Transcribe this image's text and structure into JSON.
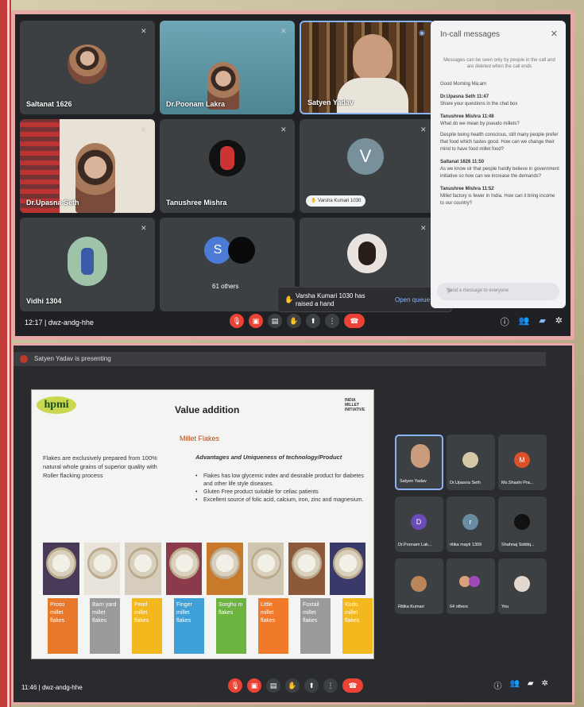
{
  "top": {
    "tiles": [
      {
        "name": "Saltanat 1626"
      },
      {
        "name": "Dr.Poonam Lakra"
      },
      {
        "name": "Satyen Yadav"
      },
      {
        "name": "Dr.Upasna Seth"
      },
      {
        "name": "Tanushree Mishra"
      },
      {
        "name": "Varsha Kumari 1030",
        "initial": "V"
      },
      {
        "name": "Vidhi 1304"
      },
      {
        "name": "61 others",
        "initial": "S"
      },
      {
        "name": ""
      }
    ],
    "chat": {
      "title": "In-call messages",
      "note": "Messages can be seen only by people in the call and are deleted when the call ends",
      "messages": [
        {
          "who": "",
          "text": "Good Morning Ma;am"
        },
        {
          "who": "Dr.Upasna Seth  11:47",
          "text": "Share your questions in the chat box"
        },
        {
          "who": "Tanushree Mishra  11:48",
          "text": "What do we mean by pseudo millets?"
        },
        {
          "who": "",
          "text": "Despite being health conscious, still many people prefer that food which tastes good. How can we change their mind to have food millet food?"
        },
        {
          "who": "Saltanat 1626  11:50",
          "text": "As we know sir that people hardly believe in government initiative so how can we increase the demands?"
        },
        {
          "who": "Tanushree Mishra  11:52",
          "text": "Millet factory is fewer in India. How can it bring income to our country?"
        }
      ],
      "input_placeholder": "Send a message to everyone"
    },
    "toast": {
      "text": "Varsha Kumari 1030 has raised a hand",
      "action": "Open queue"
    },
    "time_code": "12:17  |  dwz-andg-hhe"
  },
  "bottom": {
    "presenting": "Satyen Yadav is presenting",
    "slide": {
      "logo": "hpmi",
      "title": "Value addition",
      "logo_right": "INDIA MILLET INITIATIVE",
      "subtitle": "Millet Flakes",
      "left_text": "Flakes are exclusively prepared from 100% natural whole grains of superior quality with Roller flacking process",
      "adv_title": "Advantages and Uniqueness of technology/Product",
      "bullets": [
        "Flakes has low glycemic index and desirable product for diabetes and other life style diseases.",
        "Gluten Free product suitable for celiac patients",
        "Excellent source of folic acid, calcium, iron, zinc and magnesium."
      ],
      "labels": [
        {
          "text": "Proso millet flakes",
          "color": "#e8782a"
        },
        {
          "text": "Barn yard millet flakes",
          "color": "#9a9a9a"
        },
        {
          "text": "Pearl millet flakes",
          "color": "#f3b81e"
        },
        {
          "text": "Finger millet flakes",
          "color": "#3fa0d8"
        },
        {
          "text": "Sorghu m flakes",
          "color": "#6db33f"
        },
        {
          "text": "Little millet flakes",
          "color": "#f07a2a"
        },
        {
          "text": "Foxtail millet flakes",
          "color": "#9a9a9a"
        },
        {
          "text": "Kodo millet flakes",
          "color": "#f3b81e"
        }
      ]
    },
    "participants": [
      {
        "name": "Satyen Yadav",
        "initial": "",
        "color": ""
      },
      {
        "name": "Dr.Upasna Seth",
        "initial": "",
        "color": ""
      },
      {
        "name": "Ms.Shashi Pra...",
        "initial": "M",
        "color": "#d9502a"
      },
      {
        "name": "Dr.Poonam Lak...",
        "initial": "D",
        "color": "#6a4bb8"
      },
      {
        "name": "ritika mayti 1309",
        "initial": "r",
        "color": "#6a8ca0"
      },
      {
        "name": "Shahnaj Siddiq...",
        "initial": "",
        "color": "#111"
      },
      {
        "name": "Ritika Kumari",
        "initial": "",
        "color": ""
      },
      {
        "name": "64 others",
        "initial": "",
        "color": ""
      },
      {
        "name": "You",
        "initial": "",
        "color": ""
      }
    ],
    "time_code": "11:46  |  dwz-andg-hhe"
  }
}
